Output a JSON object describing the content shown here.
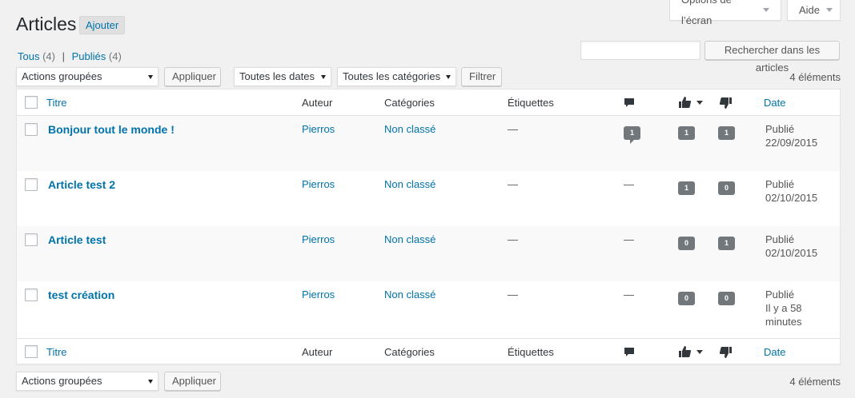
{
  "screen_options": {
    "label": "Options de l’écran",
    "help": "Aide"
  },
  "page": {
    "title": "Articles",
    "add_new": "Ajouter"
  },
  "views": {
    "all_label": "Tous",
    "all_count": "(4)",
    "separator": "|",
    "published_label": "Publiés",
    "published_count": "(4)"
  },
  "search": {
    "value": "",
    "button": "Rechercher dans les articles"
  },
  "top_filters": {
    "bulk_action": "Actions groupées",
    "apply": "Appliquer",
    "dates": "Toutes les dates",
    "categories": "Toutes les catégories",
    "filter": "Filtrer",
    "count": "4 éléments"
  },
  "bottom_filters": {
    "bulk_action": "Actions groupées",
    "apply": "Appliquer",
    "count": "4 éléments"
  },
  "columns": {
    "title": "Titre",
    "author": "Auteur",
    "categories": "Catégories",
    "tags": "Étiquettes",
    "date": "Date"
  },
  "icons": {
    "comments": "comment-icon",
    "likes": "thumbs-up-icon",
    "dislikes": "thumbs-down-icon"
  },
  "colors": {
    "link": "#0073aa",
    "badge": "#72777c"
  },
  "rows": [
    {
      "title": "Bonjour tout le monde !",
      "author": "Pierros",
      "category": "Non classé",
      "tags": "—",
      "comments": "1",
      "likes": "1",
      "dislikes": "1",
      "date_status": "Publié",
      "date_value": "22/09/2015"
    },
    {
      "title": "Article test 2",
      "author": "Pierros",
      "category": "Non classé",
      "tags": "—",
      "comments": "—",
      "likes": "1",
      "dislikes": "0",
      "date_status": "Publié",
      "date_value": "02/10/2015"
    },
    {
      "title": "Article test",
      "author": "Pierros",
      "category": "Non classé",
      "tags": "—",
      "comments": "—",
      "likes": "0",
      "dislikes": "1",
      "date_status": "Publié",
      "date_value": "02/10/2015"
    },
    {
      "title": "test création",
      "author": "Pierros",
      "category": "Non classé",
      "tags": "—",
      "comments": "—",
      "likes": "0",
      "dislikes": "0",
      "date_status": "Publié",
      "date_value": "Il y a 58 minutes"
    }
  ]
}
